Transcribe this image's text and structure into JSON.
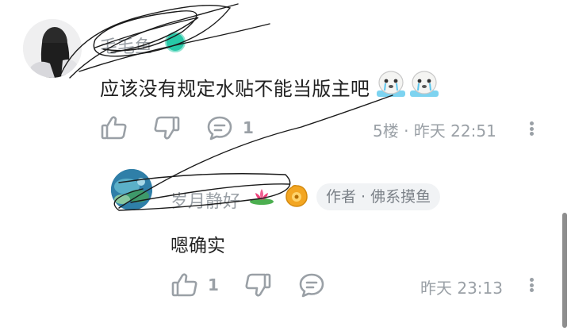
{
  "main_comment": {
    "username": "毛毛鱼",
    "text": "应该没有规定水贴不能当版主吧",
    "floor_time": "5楼 · 昨天 22:51",
    "reply_count": "1",
    "emoji_icons": [
      "seal-crying-icon",
      "seal-crying-icon"
    ]
  },
  "reply_comment": {
    "username": "岁月静好",
    "author_tag": "作者 · 佛系摸鱼",
    "text": "嗯确实",
    "like_count": "1",
    "time": "昨天 23:13",
    "name_icons": [
      "lotus-icon",
      "level-badge-icon"
    ]
  },
  "colors": {
    "meta_gray": "#9aa0a6",
    "text_dark": "#222222",
    "tag_bg": "#f1f3f5",
    "badge_teal": "#27c9a8"
  }
}
